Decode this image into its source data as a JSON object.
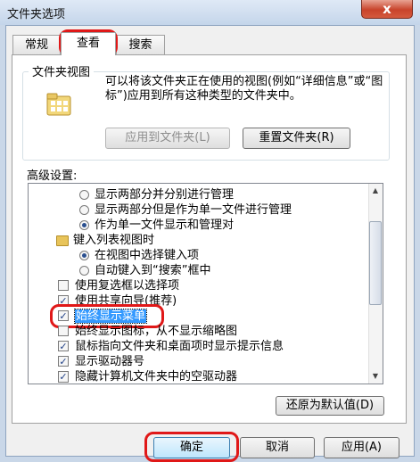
{
  "window": {
    "title": "文件夹选项",
    "close_label": "x"
  },
  "tabs": [
    {
      "label": "常规",
      "selected": false
    },
    {
      "label": "查看",
      "selected": true
    },
    {
      "label": "搜索",
      "selected": false
    }
  ],
  "folder_views": {
    "title": "文件夹视图",
    "description": "可以将该文件夹正在使用的视图(例如“详细信息”或“图标”)应用到所有这种类型的文件夹中。",
    "apply_button": "应用到文件夹(L)",
    "reset_button": "重置文件夹(R)"
  },
  "advanced": {
    "label": "高级设置:",
    "items": [
      {
        "type": "radio",
        "checked": false,
        "label": "显示两部分并分别进行管理"
      },
      {
        "type": "radio",
        "checked": false,
        "label": "显示两部分但是作为单一文件进行管理"
      },
      {
        "type": "radio",
        "checked": true,
        "label": "作为单一文件显示和管理对"
      },
      {
        "type": "folder",
        "label": "键入列表视图时"
      },
      {
        "type": "radio",
        "checked": true,
        "label": "在视图中选择键入项"
      },
      {
        "type": "radio",
        "checked": false,
        "label": "自动键入到“搜索”框中"
      },
      {
        "type": "checkbox",
        "checked": false,
        "label": "使用复选框以选择项"
      },
      {
        "type": "checkbox",
        "checked": true,
        "label": "使用共享向导(推荐)"
      },
      {
        "type": "checkbox",
        "checked": true,
        "label": "始终显示菜单"
      },
      {
        "type": "checkbox",
        "checked": false,
        "label": "始终显示图标，从不显示缩略图"
      },
      {
        "type": "checkbox",
        "checked": true,
        "label": "鼠标指向文件夹和桌面项时显示提示信息"
      },
      {
        "type": "checkbox",
        "checked": true,
        "label": "显示驱动器号"
      },
      {
        "type": "checkbox",
        "checked": true,
        "label": "隐藏计算机文件夹中的空驱动器"
      }
    ],
    "restore_button": "还原为默认值(D)"
  },
  "footer": {
    "ok": "确定",
    "cancel": "取消",
    "apply": "应用(A)"
  },
  "accent_colors": {
    "annotation_red": "#e01818",
    "selection_blue": "#3399ff"
  }
}
